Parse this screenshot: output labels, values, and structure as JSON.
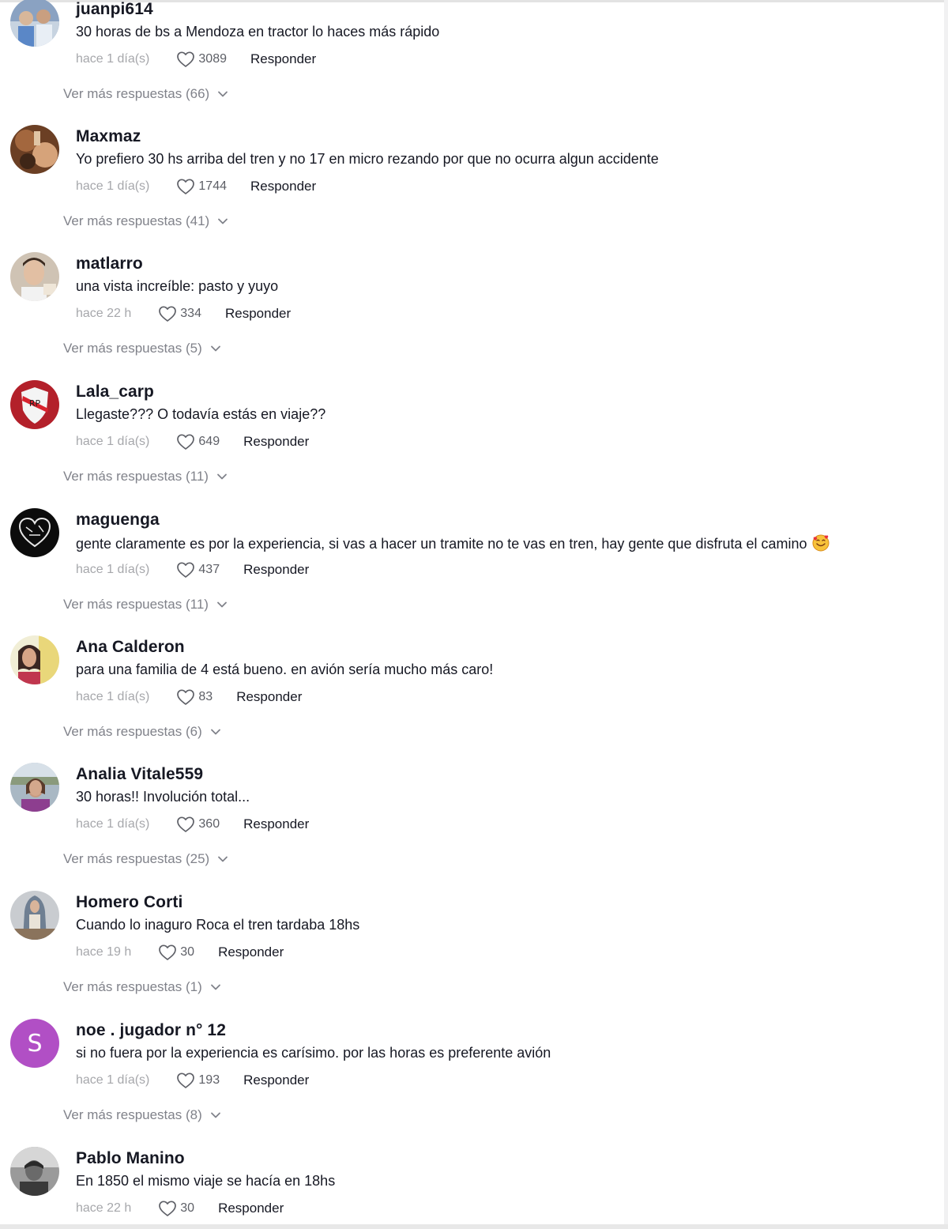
{
  "comments": [
    {
      "username": "juanpi614",
      "text": "30 horas de bs a Mendoza en tractor lo haces más rápido",
      "time": "hace 1 día(s)",
      "likes": "3089",
      "reply": "Responder",
      "more": "Ver más respuestas (66)",
      "avatar_color": "#8aa2c2"
    },
    {
      "username": "Maxmaz",
      "text": "Yo prefiero 30 hs arriba del tren y no 17 en micro rezando por que no ocurra algun accidente",
      "time": "hace 1 día(s)",
      "likes": "1744",
      "reply": "Responder",
      "more": "Ver más respuestas (41)",
      "avatar_color": "#7a4a2c"
    },
    {
      "username": "matlarro",
      "text": "una vista increíble: pasto y yuyo",
      "time": "hace 22 h",
      "likes": "334",
      "reply": "Responder",
      "more": "Ver más respuestas (5)",
      "avatar_color": "#b9a48e"
    },
    {
      "username": "Lala_carp",
      "text": "Llegaste??? O todavía estás en viaje??",
      "time": "hace 1 día(s)",
      "likes": "649",
      "reply": "Responder",
      "more": "Ver más respuestas (11)",
      "avatar_color": "#b3202a"
    },
    {
      "username": "maguenga",
      "text": "gente claramente es por la experiencia, si vas a hacer un tramite no te vas en tren, hay gente que disfruta el camino",
      "time": "hace 1 día(s)",
      "likes": "437",
      "reply": "Responder",
      "more": "Ver más respuestas (11)",
      "avatar_color": "#111111"
    },
    {
      "username": "Ana Calderon",
      "text": "para una familia de 4 está bueno. en avión sería mucho más caro!",
      "time": "hace 1 día(s)",
      "likes": "83",
      "reply": "Responder",
      "more": "Ver más respuestas (6)",
      "avatar_color": "#c9b36a"
    },
    {
      "username": "Analia Vitale559",
      "text": "30 horas!! Involución total...",
      "time": "hace 1 día(s)",
      "likes": "360",
      "reply": "Responder",
      "more": "Ver más respuestas (25)",
      "avatar_color": "#7f8e9b"
    },
    {
      "username": "Homero Corti",
      "text": "Cuando lo inaguro Roca el tren tardaba 18hs",
      "time": "hace 19 h",
      "likes": "30",
      "reply": "Responder",
      "more": "Ver más respuestas (1)",
      "avatar_color": "#7c8794"
    },
    {
      "username": "noe . jugador n° 12",
      "text": "si no fuera por la experiencia es carísimo. por las horas es preferente avión",
      "time": "hace 1 día(s)",
      "likes": "193",
      "reply": "Responder",
      "more": "Ver más respuestas (8)",
      "avatar_color": "#b14fc5",
      "avatar_letter": "S"
    },
    {
      "username": "Pablo Manino",
      "text": "En 1850 el mismo viaje se hacía en 18hs",
      "time": "hace 22 h",
      "likes": "30",
      "reply": "Responder",
      "avatar_color": "#5a5a5a"
    }
  ]
}
